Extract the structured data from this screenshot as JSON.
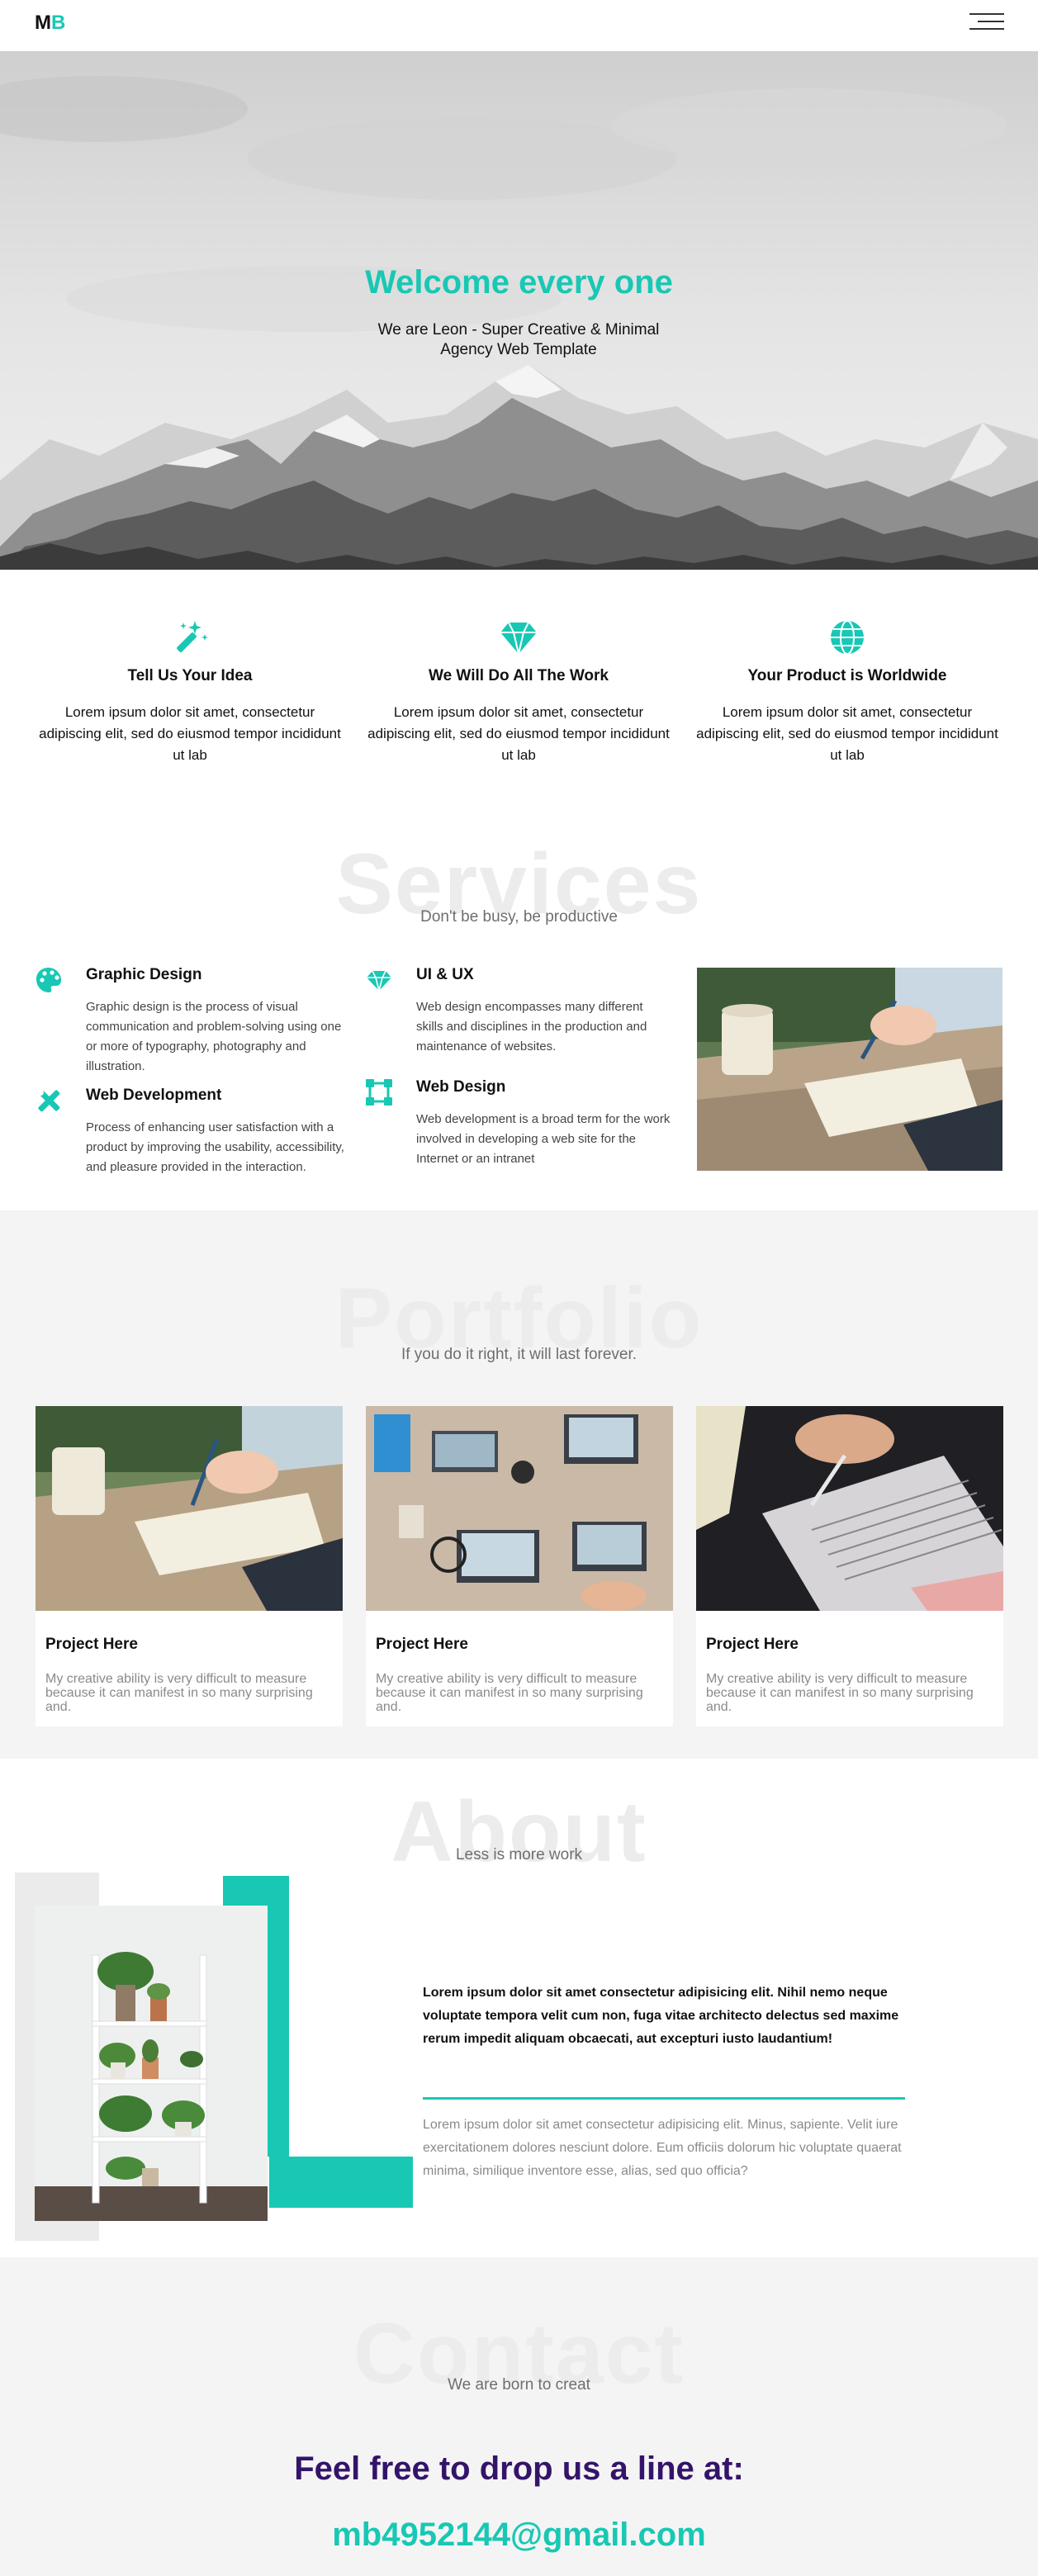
{
  "nav": {
    "logo_m": "M",
    "logo_b": "B"
  },
  "hero": {
    "title": "Welcome every one",
    "subtitle": "We are Leon - Super Creative & Minimal Agency Web Template"
  },
  "features": [
    {
      "icon": "magic-wand-icon",
      "title": "Tell Us Your Idea",
      "text": "Lorem ipsum dolor sit amet, consectetur adipiscing elit, sed do eiusmod tempor incididunt ut lab"
    },
    {
      "icon": "diamond-icon",
      "title": "We Will Do All The Work",
      "text": "Lorem ipsum dolor sit amet, consectetur adipiscing elit, sed do eiusmod tempor incididunt ut lab"
    },
    {
      "icon": "globe-icon",
      "title": "Your Product is Worldwide",
      "text": "Lorem ipsum dolor sit amet, consectetur adipiscing elit, sed do eiusmod tempor incididunt ut lab"
    }
  ],
  "services": {
    "bigword": "Services",
    "subtitle": "Don't be busy, be productive",
    "items": [
      {
        "icon": "palette-icon",
        "title": "Graphic Design",
        "text": "Graphic design is the process of visual communication and problem-solving using one or more of typography, photography and illustration."
      },
      {
        "icon": "diamond-icon",
        "title": "UI & UX",
        "text": "Web design encompasses many different skills and disciplines in the production and maintenance of websites."
      },
      {
        "icon": "tools-icon",
        "title": "Web Development",
        "text": "Process of enhancing user satisfaction with a product by improving the usability, accessibility, and pleasure provided in the interaction."
      },
      {
        "icon": "vector-square-icon",
        "title": "Web Design",
        "text": "Web development is a broad term for the work involved in developing a web site for the Internet or an intranet"
      }
    ]
  },
  "portfolio": {
    "bigword": "Portfolio",
    "subtitle": "If you do it right, it will last forever.",
    "cards": [
      {
        "title": "Project Here",
        "text": "My creative ability is very difficult to measure because it can manifest in so many surprising and."
      },
      {
        "title": "Project Here",
        "text": "My creative ability is very difficult to measure because it can manifest in so many surprising and."
      },
      {
        "title": "Project Here",
        "text": "My creative ability is very difficult to measure because it can manifest in so many surprising and."
      }
    ]
  },
  "about": {
    "bigword": "About",
    "subtitle": "Less is more work",
    "lead": "Lorem ipsum dolor sit amet consectetur adipisicing elit. Nihil nemo neque voluptate tempora velit cum non, fuga vitae architecto delectus sed maxime rerum impedit aliquam obcaecati, aut excepturi iusto laudantium!",
    "body": "Lorem ipsum dolor sit amet consectetur adipisicing elit. Minus, sapiente. Velit iure exercitationem dolores nesciunt dolore. Eum officiis dolorum hic voluptate quaerat minima, similique inventore esse, alias, sed quo officia?"
  },
  "contact": {
    "bigword": "Contact",
    "subtitle": "We are born to creat",
    "heading": "Feel free to drop us a line at:",
    "email": "mb4952144@gmail.com"
  },
  "colors": {
    "accent": "#18c8b4",
    "heading_purple": "#34146a",
    "light_bg": "#f4f4f4"
  }
}
